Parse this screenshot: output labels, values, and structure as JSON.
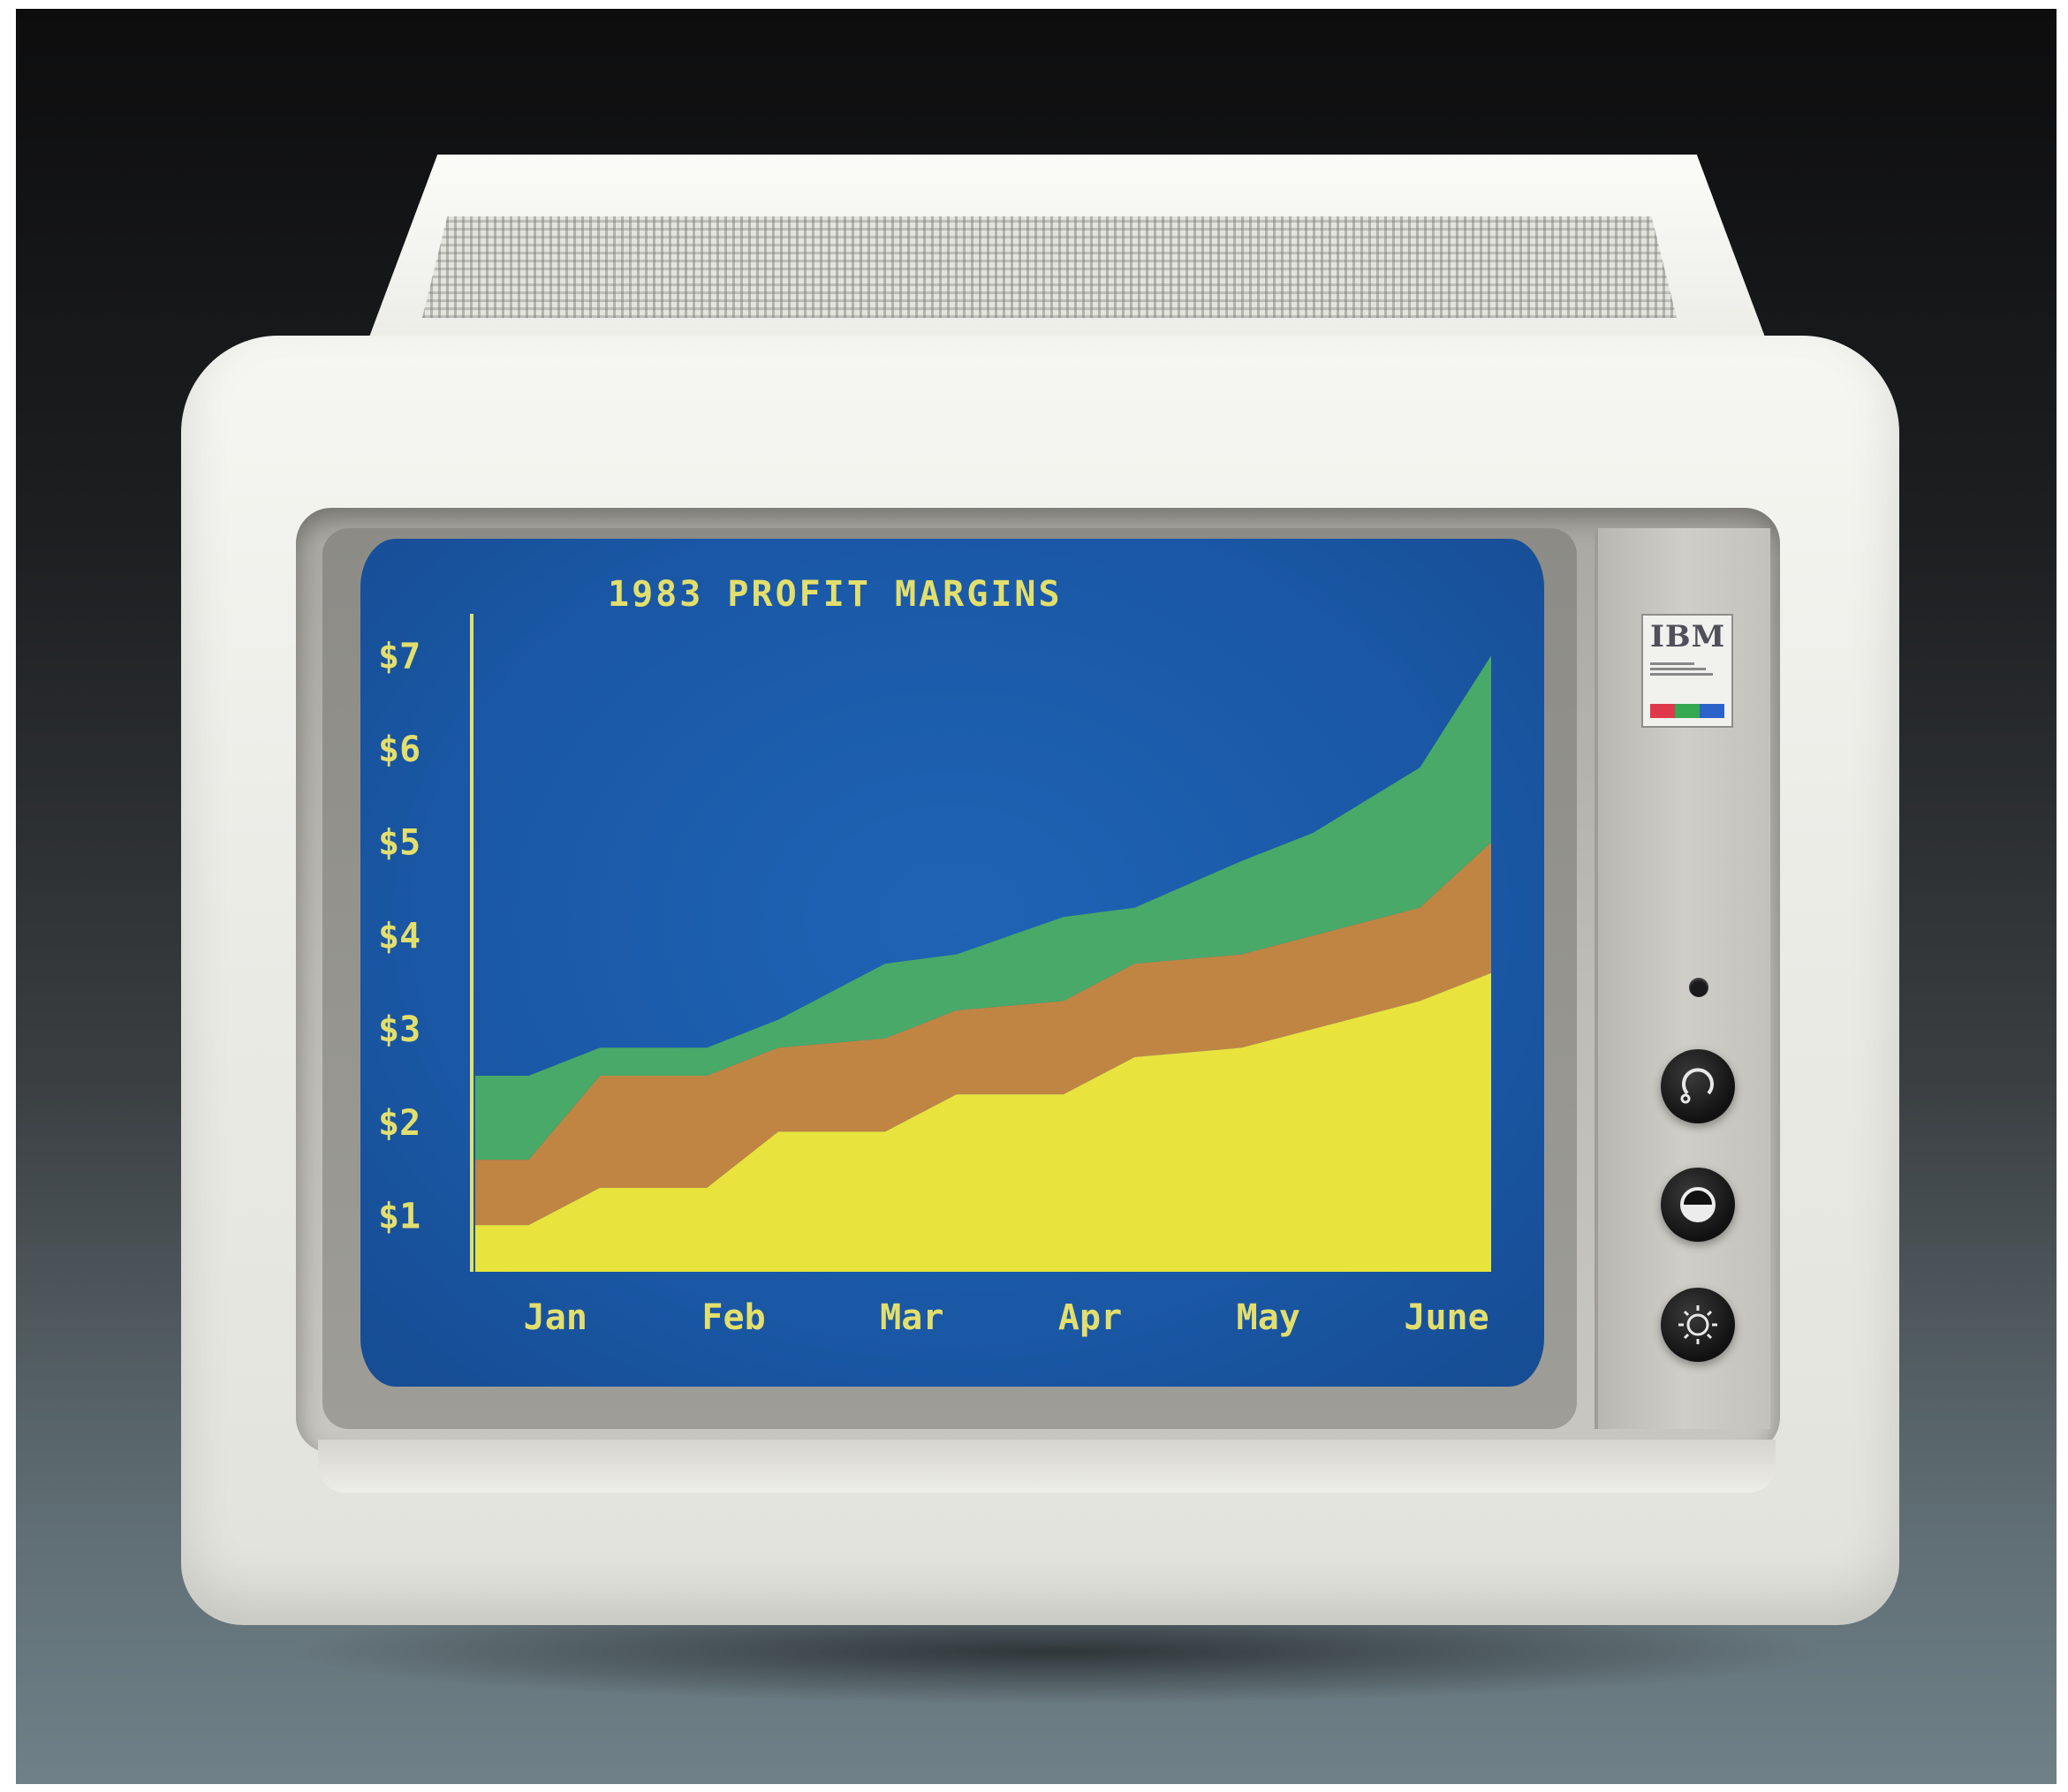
{
  "screen": {
    "title": "1983 PROFIT MARGINS",
    "bg_color": "#1a58a6",
    "text_color": "#e3df6d"
  },
  "badge": {
    "logo": "IBM",
    "stripe_colors": [
      "#e0384b",
      "#35a852",
      "#2c63c9"
    ]
  },
  "chart_data": {
    "type": "area",
    "stacked": true,
    "title": "1983 PROFIT MARGINS",
    "categories": [
      "Jan",
      "Feb",
      "Mar",
      "Apr",
      "May",
      "June"
    ],
    "y_ticks": [
      "$1",
      "$2",
      "$3",
      "$4",
      "$5",
      "$6",
      "$7"
    ],
    "ylim": [
      0.4,
      7.4
    ],
    "x": [
      0.0,
      0.3,
      0.7,
      1.3,
      1.7,
      2.3,
      2.7,
      3.3,
      3.7,
      4.3,
      4.7,
      5.3,
      5.7
    ],
    "series": [
      {
        "color": "#e9e33d",
        "values": [
          0.9,
          0.9,
          1.3,
          1.3,
          1.9,
          1.9,
          2.3,
          2.3,
          2.7,
          2.8,
          3.0,
          3.3,
          3.6
        ]
      },
      {
        "color": "#c08543",
        "values": [
          1.6,
          1.6,
          2.5,
          2.5,
          2.8,
          2.9,
          3.2,
          3.3,
          3.7,
          3.8,
          4.0,
          4.3,
          5.0
        ]
      },
      {
        "color": "#49a968",
        "values": [
          2.5,
          2.5,
          2.8,
          2.8,
          3.1,
          3.7,
          3.8,
          4.2,
          4.3,
          4.8,
          5.1,
          5.8,
          7.0
        ]
      }
    ]
  }
}
